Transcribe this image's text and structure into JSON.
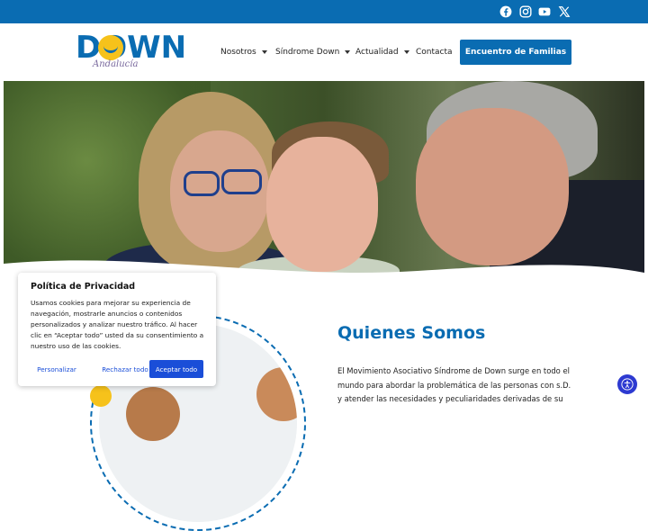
{
  "topbar": {
    "social": [
      {
        "icon": "facebook-icon"
      },
      {
        "icon": "instagram-icon"
      },
      {
        "icon": "youtube-icon"
      },
      {
        "icon": "x-twitter-icon"
      }
    ],
    "color": "#0a6cb2"
  },
  "logo": {
    "main": "DOWN",
    "sub": "Andalucía"
  },
  "nav": {
    "items": [
      {
        "label": "Nosotros",
        "has_dropdown": true
      },
      {
        "label": "Síndrome Down",
        "has_dropdown": true
      },
      {
        "label": "Actualidad",
        "has_dropdown": true
      },
      {
        "label": "Contacta",
        "has_dropdown": false
      }
    ],
    "cta": "Encuentro de Familias"
  },
  "cookie": {
    "title": "Política de Privacidad",
    "body": "Usamos cookies para mejorar su experiencia de navegación, mostrarle anuncios o contenidos personalizados y analizar nuestro tráfico. Al hacer clic en “Aceptar todo” usted da su consentimiento a nuestro uso de las cookies.",
    "customize": "Personalizar",
    "reject": "Rechazar todo",
    "accept": "Aceptar todo"
  },
  "about": {
    "title": "Quienes Somos",
    "text": "El Movimiento Asociativo Síndrome de Down surge en todo el mundo para abordar la problemática de las personas con s.D. y atender las necesidades y peculiaridades derivadas de su"
  },
  "accessibility": {
    "icon": "accessibility-icon"
  },
  "colors": {
    "brand": "#0a6cb2",
    "accent": "#f6c21b",
    "button": "#1a4ed8"
  }
}
